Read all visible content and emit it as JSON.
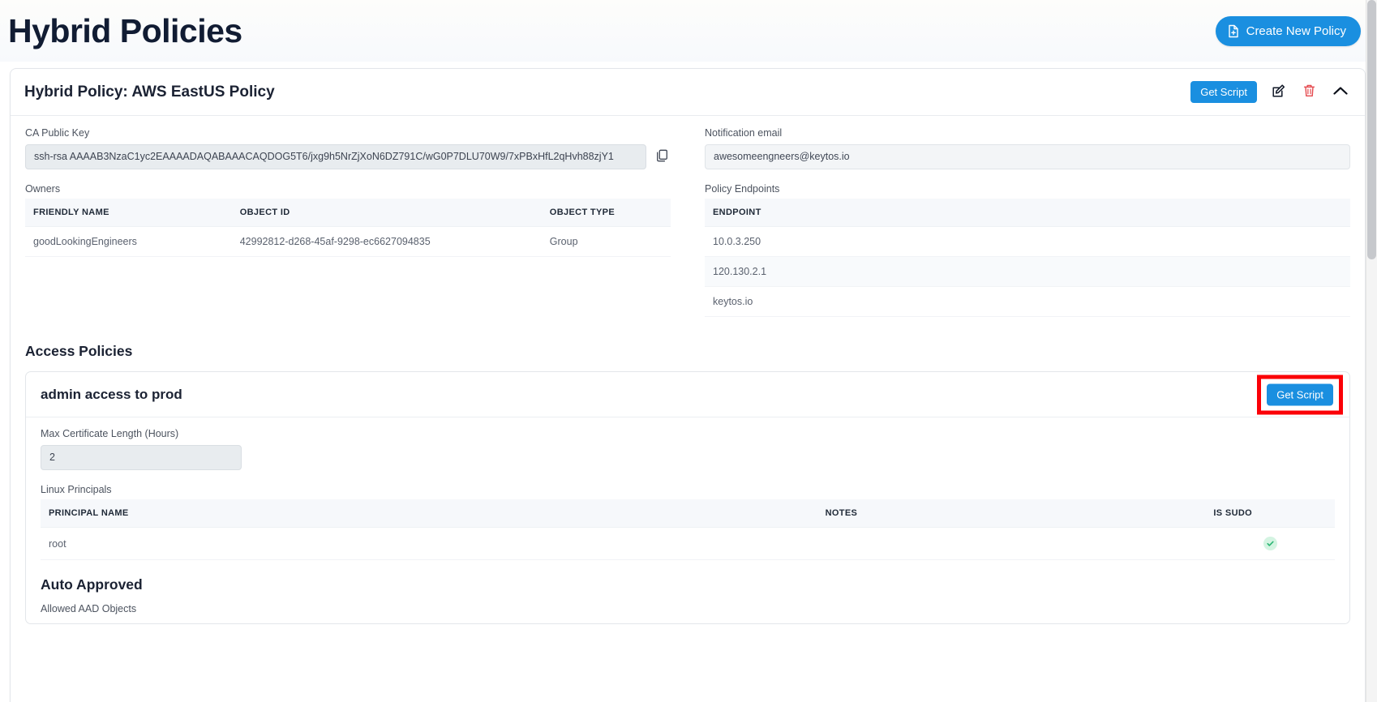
{
  "header": {
    "title": "Hybrid Policies",
    "create_button": "Create New Policy",
    "create_icon": "file-plus-icon"
  },
  "policy_card": {
    "title": "Hybrid Policy: AWS EastUS Policy",
    "get_script_label": "Get Script",
    "edit_icon": "edit-pencil-icon",
    "delete_icon": "trash-icon",
    "collapse_icon": "chevron-up-icon",
    "ca_public_key": {
      "label": "CA Public Key",
      "value": "ssh-rsa AAAAB3NzaC1yc2EAAAADAQABAAACAQDOG5T6/jxg9h5NrZjXoN6DZ791C/wG0P7DLU70W9/7xPBxHfL2qHvh88zjY1",
      "copy_icon": "copy-icon"
    },
    "notification_email": {
      "label": "Notification email",
      "value": "awesomeengneers@keytos.io"
    },
    "owners": {
      "label": "Owners",
      "columns": [
        "FRIENDLY NAME",
        "OBJECT ID",
        "OBJECT TYPE"
      ],
      "rows": [
        {
          "friendly_name": "goodLookingEngineers",
          "object_id": "42992812-d268-45af-9298-ec6627094835",
          "object_type": "Group"
        }
      ]
    },
    "policy_endpoints": {
      "label": "Policy Endpoints",
      "columns": [
        "ENDPOINT"
      ],
      "rows": [
        "10.0.3.250",
        "120.130.2.1",
        "keytos.io"
      ]
    }
  },
  "access_policies": {
    "title": "Access Policies",
    "policies": [
      {
        "name": "admin access to prod",
        "get_script_label": "Get Script",
        "highlighted": true,
        "max_cert_length": {
          "label": "Max Certificate Length (Hours)",
          "value": "2"
        },
        "linux_principals": {
          "label": "Linux Principals",
          "columns": [
            "PRINCIPAL NAME",
            "NOTES",
            "IS SUDO"
          ],
          "rows": [
            {
              "principal_name": "root",
              "notes": "",
              "is_sudo": true
            }
          ]
        },
        "auto_approved": {
          "title": "Auto Approved",
          "allowed_aad_objects_label": "Allowed AAD Objects"
        }
      }
    ]
  },
  "colors": {
    "accent_blue": "#1a8fe0",
    "title_navy": "#111c33",
    "highlight_red": "#fb0007",
    "sudo_green": "#2bb673"
  }
}
